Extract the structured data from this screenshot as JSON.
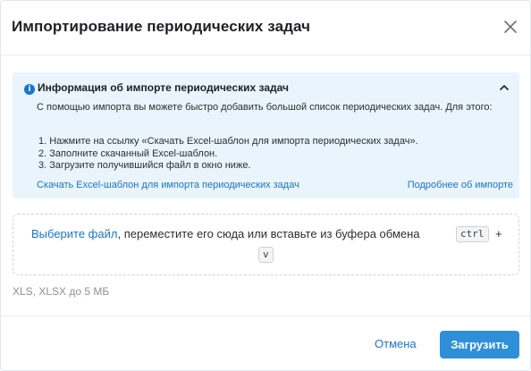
{
  "modal": {
    "title": "Импортирование периодических задач"
  },
  "info": {
    "title": "Информация об импорте периодических задач",
    "description": "С помощью импорта вы можете быстро добавить большой список периодических задач. Для этого:",
    "steps": [
      "1. Нажмите на ссылку «Скачать Excel-шаблон для импорта периодических задач».",
      "2. Заполните скачанный Excel-шаблон.",
      "3. Загрузите получившийся файл в окно ниже."
    ],
    "template_link": "Скачать Excel-шаблон для импорта периодических задач",
    "more_link": "Подробнее об импорте"
  },
  "dropzone": {
    "choose_link": "Выберите файл",
    "text": ", переместите его сюда или вставьте из буфера обмена",
    "key_ctrl": "ctrl",
    "plus": "+",
    "key_v": "v"
  },
  "hint": "XLS, XLSX до 5 МБ",
  "footer": {
    "cancel_label": "Отмена",
    "upload_label": "Загрузить"
  },
  "colors": {
    "accent": "#1a75c7",
    "primary_button": "#2f8fd8",
    "info_background": "#e9f4fc"
  },
  "icons": {
    "close": "close-icon",
    "info": "info-icon",
    "collapse": "chevron-up-icon"
  }
}
